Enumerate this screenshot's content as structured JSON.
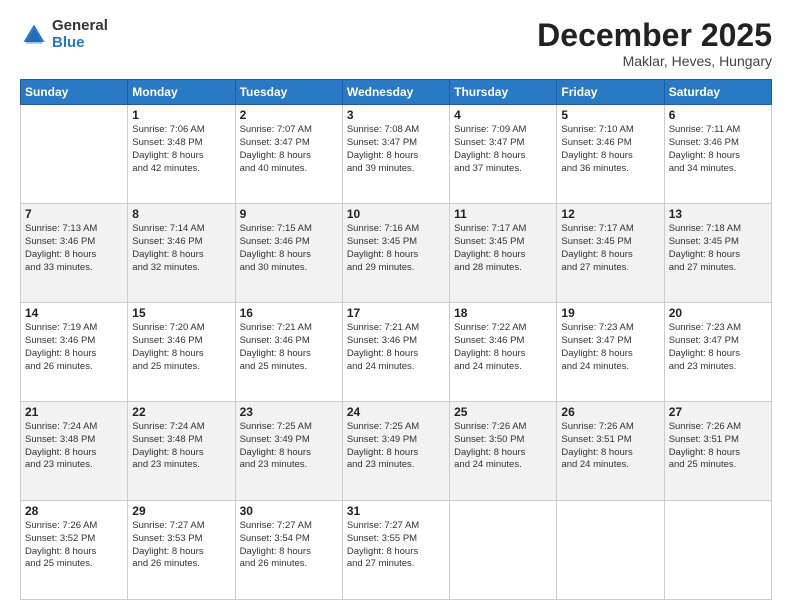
{
  "logo": {
    "general": "General",
    "blue": "Blue"
  },
  "title": "December 2025",
  "subtitle": "Maklar, Heves, Hungary",
  "days": [
    "Sunday",
    "Monday",
    "Tuesday",
    "Wednesday",
    "Thursday",
    "Friday",
    "Saturday"
  ],
  "weeks": [
    [
      {
        "day": "",
        "sunrise": "",
        "sunset": "",
        "daylight": ""
      },
      {
        "day": "1",
        "sunrise": "Sunrise: 7:06 AM",
        "sunset": "Sunset: 3:48 PM",
        "daylight": "Daylight: 8 hours and 42 minutes."
      },
      {
        "day": "2",
        "sunrise": "Sunrise: 7:07 AM",
        "sunset": "Sunset: 3:47 PM",
        "daylight": "Daylight: 8 hours and 40 minutes."
      },
      {
        "day": "3",
        "sunrise": "Sunrise: 7:08 AM",
        "sunset": "Sunset: 3:47 PM",
        "daylight": "Daylight: 8 hours and 39 minutes."
      },
      {
        "day": "4",
        "sunrise": "Sunrise: 7:09 AM",
        "sunset": "Sunset: 3:47 PM",
        "daylight": "Daylight: 8 hours and 37 minutes."
      },
      {
        "day": "5",
        "sunrise": "Sunrise: 7:10 AM",
        "sunset": "Sunset: 3:46 PM",
        "daylight": "Daylight: 8 hours and 36 minutes."
      },
      {
        "day": "6",
        "sunrise": "Sunrise: 7:11 AM",
        "sunset": "Sunset: 3:46 PM",
        "daylight": "Daylight: 8 hours and 34 minutes."
      }
    ],
    [
      {
        "day": "7",
        "sunrise": "Sunrise: 7:13 AM",
        "sunset": "Sunset: 3:46 PM",
        "daylight": "Daylight: 8 hours and 33 minutes."
      },
      {
        "day": "8",
        "sunrise": "Sunrise: 7:14 AM",
        "sunset": "Sunset: 3:46 PM",
        "daylight": "Daylight: 8 hours and 32 minutes."
      },
      {
        "day": "9",
        "sunrise": "Sunrise: 7:15 AM",
        "sunset": "Sunset: 3:46 PM",
        "daylight": "Daylight: 8 hours and 30 minutes."
      },
      {
        "day": "10",
        "sunrise": "Sunrise: 7:16 AM",
        "sunset": "Sunset: 3:45 PM",
        "daylight": "Daylight: 8 hours and 29 minutes."
      },
      {
        "day": "11",
        "sunrise": "Sunrise: 7:17 AM",
        "sunset": "Sunset: 3:45 PM",
        "daylight": "Daylight: 8 hours and 28 minutes."
      },
      {
        "day": "12",
        "sunrise": "Sunrise: 7:17 AM",
        "sunset": "Sunset: 3:45 PM",
        "daylight": "Daylight: 8 hours and 27 minutes."
      },
      {
        "day": "13",
        "sunrise": "Sunrise: 7:18 AM",
        "sunset": "Sunset: 3:45 PM",
        "daylight": "Daylight: 8 hours and 27 minutes."
      }
    ],
    [
      {
        "day": "14",
        "sunrise": "Sunrise: 7:19 AM",
        "sunset": "Sunset: 3:46 PM",
        "daylight": "Daylight: 8 hours and 26 minutes."
      },
      {
        "day": "15",
        "sunrise": "Sunrise: 7:20 AM",
        "sunset": "Sunset: 3:46 PM",
        "daylight": "Daylight: 8 hours and 25 minutes."
      },
      {
        "day": "16",
        "sunrise": "Sunrise: 7:21 AM",
        "sunset": "Sunset: 3:46 PM",
        "daylight": "Daylight: 8 hours and 25 minutes."
      },
      {
        "day": "17",
        "sunrise": "Sunrise: 7:21 AM",
        "sunset": "Sunset: 3:46 PM",
        "daylight": "Daylight: 8 hours and 24 minutes."
      },
      {
        "day": "18",
        "sunrise": "Sunrise: 7:22 AM",
        "sunset": "Sunset: 3:46 PM",
        "daylight": "Daylight: 8 hours and 24 minutes."
      },
      {
        "day": "19",
        "sunrise": "Sunrise: 7:23 AM",
        "sunset": "Sunset: 3:47 PM",
        "daylight": "Daylight: 8 hours and 24 minutes."
      },
      {
        "day": "20",
        "sunrise": "Sunrise: 7:23 AM",
        "sunset": "Sunset: 3:47 PM",
        "daylight": "Daylight: 8 hours and 23 minutes."
      }
    ],
    [
      {
        "day": "21",
        "sunrise": "Sunrise: 7:24 AM",
        "sunset": "Sunset: 3:48 PM",
        "daylight": "Daylight: 8 hours and 23 minutes."
      },
      {
        "day": "22",
        "sunrise": "Sunrise: 7:24 AM",
        "sunset": "Sunset: 3:48 PM",
        "daylight": "Daylight: 8 hours and 23 minutes."
      },
      {
        "day": "23",
        "sunrise": "Sunrise: 7:25 AM",
        "sunset": "Sunset: 3:49 PM",
        "daylight": "Daylight: 8 hours and 23 minutes."
      },
      {
        "day": "24",
        "sunrise": "Sunrise: 7:25 AM",
        "sunset": "Sunset: 3:49 PM",
        "daylight": "Daylight: 8 hours and 23 minutes."
      },
      {
        "day": "25",
        "sunrise": "Sunrise: 7:26 AM",
        "sunset": "Sunset: 3:50 PM",
        "daylight": "Daylight: 8 hours and 24 minutes."
      },
      {
        "day": "26",
        "sunrise": "Sunrise: 7:26 AM",
        "sunset": "Sunset: 3:51 PM",
        "daylight": "Daylight: 8 hours and 24 minutes."
      },
      {
        "day": "27",
        "sunrise": "Sunrise: 7:26 AM",
        "sunset": "Sunset: 3:51 PM",
        "daylight": "Daylight: 8 hours and 25 minutes."
      }
    ],
    [
      {
        "day": "28",
        "sunrise": "Sunrise: 7:26 AM",
        "sunset": "Sunset: 3:52 PM",
        "daylight": "Daylight: 8 hours and 25 minutes."
      },
      {
        "day": "29",
        "sunrise": "Sunrise: 7:27 AM",
        "sunset": "Sunset: 3:53 PM",
        "daylight": "Daylight: 8 hours and 26 minutes."
      },
      {
        "day": "30",
        "sunrise": "Sunrise: 7:27 AM",
        "sunset": "Sunset: 3:54 PM",
        "daylight": "Daylight: 8 hours and 26 minutes."
      },
      {
        "day": "31",
        "sunrise": "Sunrise: 7:27 AM",
        "sunset": "Sunset: 3:55 PM",
        "daylight": "Daylight: 8 hours and 27 minutes."
      },
      {
        "day": "",
        "sunrise": "",
        "sunset": "",
        "daylight": ""
      },
      {
        "day": "",
        "sunrise": "",
        "sunset": "",
        "daylight": ""
      },
      {
        "day": "",
        "sunrise": "",
        "sunset": "",
        "daylight": ""
      }
    ]
  ]
}
